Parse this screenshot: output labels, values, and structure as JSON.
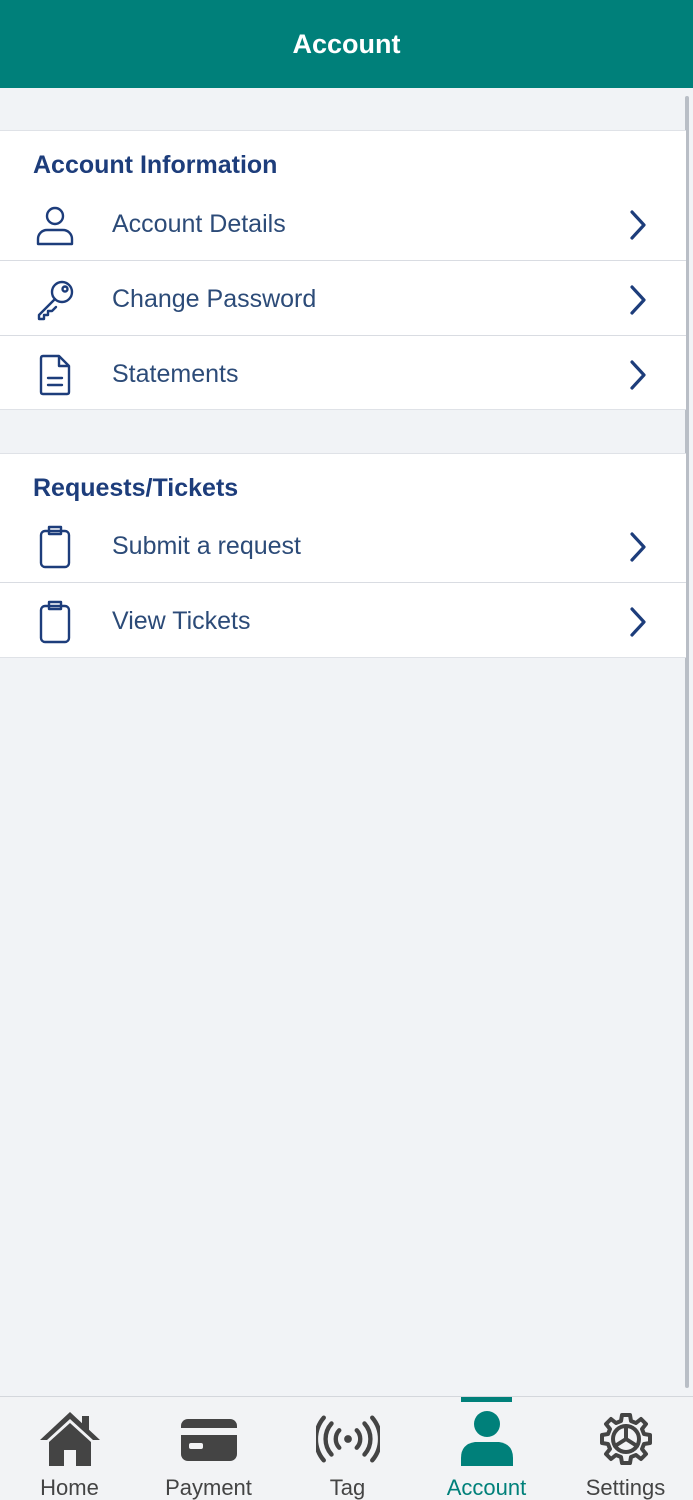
{
  "header": {
    "title": "Account"
  },
  "sections": [
    {
      "title": "Account Information",
      "items": [
        {
          "label": "Account Details",
          "icon": "user-icon"
        },
        {
          "label": "Change Password",
          "icon": "key-icon"
        },
        {
          "label": "Statements",
          "icon": "document-icon"
        }
      ]
    },
    {
      "title": "Requests/Tickets",
      "items": [
        {
          "label": "Submit a request",
          "icon": "clipboard-icon"
        },
        {
          "label": "View Tickets",
          "icon": "clipboard-icon"
        }
      ]
    }
  ],
  "bottom_nav": {
    "items": [
      {
        "label": "Home",
        "icon": "home-icon"
      },
      {
        "label": "Payment",
        "icon": "credit-card-icon"
      },
      {
        "label": "Tag",
        "icon": "signal-tag-icon"
      },
      {
        "label": "Account",
        "icon": "person-icon",
        "active": true
      },
      {
        "label": "Settings",
        "icon": "gear-icon"
      }
    ]
  },
  "colors": {
    "header": "#00807a",
    "accent_text": "#1d3d7b",
    "row_text": "#2c4b78",
    "active_nav": "#00807a",
    "inactive_nav": "#444444",
    "background": "#f1f3f6"
  }
}
